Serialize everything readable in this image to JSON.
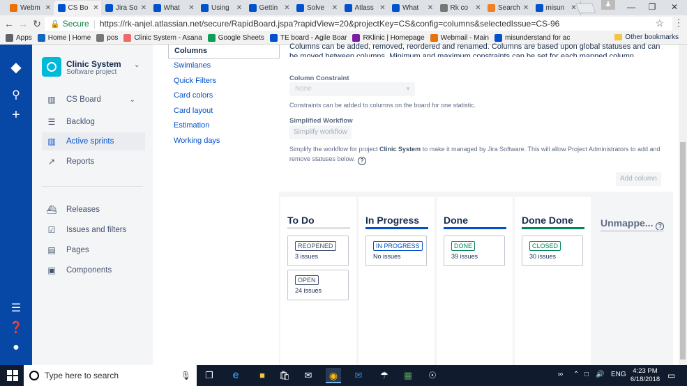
{
  "browser": {
    "tabs": [
      {
        "title": "Webm",
        "favicon": "cp",
        "color": "#e8710a"
      },
      {
        "title": "CS Bo",
        "favicon": "jira",
        "color": "#0052cc",
        "active": true
      },
      {
        "title": "Jira So",
        "favicon": "atlassian",
        "color": "#0052cc"
      },
      {
        "title": "What",
        "favicon": "atlassian",
        "color": "#0052cc"
      },
      {
        "title": "Using",
        "favicon": "atlassian",
        "color": "#0052cc"
      },
      {
        "title": "Gettin",
        "favicon": "atlassian",
        "color": "#0052cc"
      },
      {
        "title": "Solve",
        "favicon": "atlassian",
        "color": "#0052cc"
      },
      {
        "title": "Atlass",
        "favicon": "atlassian",
        "color": "#0052cc"
      },
      {
        "title": "What",
        "favicon": "atlassian",
        "color": "#0052cc"
      },
      {
        "title": "Rk co",
        "favicon": "doc",
        "color": "#777777"
      },
      {
        "title": "Search",
        "favicon": "so",
        "color": "#f48024"
      },
      {
        "title": "misun",
        "favicon": "atlassian",
        "color": "#0052cc"
      }
    ],
    "secure_label": "Secure",
    "url": "https://rk-anjel.atlassian.net/secure/RapidBoard.jspa?rapidView=20&projectKey=CS&config=columns&selectedIssue=CS-96",
    "bookmarks": [
      {
        "label": "Apps",
        "icon": "apps-icon",
        "color": "#5f6368"
      },
      {
        "label": "Home | Home",
        "icon": "home-icon",
        "color": "#1565c0"
      },
      {
        "label": "pos",
        "icon": "doc-icon",
        "color": "#777777"
      },
      {
        "label": "Clinic System - Asana",
        "icon": "asana-icon",
        "color": "#f06a6a"
      },
      {
        "label": "Google Sheets",
        "icon": "sheets-icon",
        "color": "#0f9d58"
      },
      {
        "label": "TE board - Agile Boar",
        "icon": "jira-icon",
        "color": "#0052cc"
      },
      {
        "label": "RKlinic | Homepage",
        "icon": "rk-icon",
        "color": "#7b1fa2"
      },
      {
        "label": "Webmail - Main",
        "icon": "cp-icon",
        "color": "#e8710a"
      },
      {
        "label": "misunderstand for ac",
        "icon": "atlassian-icon",
        "color": "#0052cc"
      }
    ],
    "other_bookmarks": "Other bookmarks"
  },
  "project": {
    "name": "Clinic System",
    "type": "Software project",
    "nav": [
      {
        "label": "CS Board",
        "icon": "board-icon",
        "chevron": true
      },
      {
        "label": "Backlog",
        "icon": "backlog-icon"
      },
      {
        "label": "Active sprints",
        "icon": "sprints-icon",
        "active": true
      },
      {
        "label": "Reports",
        "icon": "reports-icon"
      },
      {
        "label": "Releases",
        "icon": "releases-icon"
      },
      {
        "label": "Issues and filters",
        "icon": "issues-icon"
      },
      {
        "label": "Pages",
        "icon": "pages-icon"
      },
      {
        "label": "Components",
        "icon": "components-icon"
      }
    ]
  },
  "config_menu": {
    "active": "Columns",
    "items": [
      "Swimlanes",
      "Quick Filters",
      "Card colors",
      "Card layout",
      "Estimation",
      "Working days"
    ]
  },
  "main": {
    "intro": "Columns can be added, removed, reordered and renamed. Columns are based upon global statuses and can be moved between columns. Minimum and maximum constraints can be set for each mapped column.",
    "constraint_label": "Column Constraint",
    "constraint_value": "None",
    "constraint_help": "Constraints can be added to columns on the board for one statistic.",
    "workflow_label": "Simplified Workflow",
    "workflow_button": "Simplify workflow",
    "workflow_help_1": "Simplify the workflow for project ",
    "workflow_help_project": "Clinic System",
    "workflow_help_2": " to make it managed by Jira Software. This will allow Project Administrators to add and remove statuses below.",
    "add_column": "Add column",
    "columns": [
      {
        "title": "To Do",
        "bar": "#dfe1e6",
        "cards": [
          {
            "status": "REOPENED",
            "issues": "3 issues",
            "color": "#42526e"
          },
          {
            "status": "OPEN",
            "issues": "24 issues",
            "color": "#42526e"
          }
        ]
      },
      {
        "title": "In Progress",
        "bar": "#0052cc",
        "cards": [
          {
            "status": "IN PROGRESS",
            "issues": "No issues",
            "color": "#0052cc"
          }
        ]
      },
      {
        "title": "Done",
        "bar": "#0052cc",
        "cards": [
          {
            "status": "DONE",
            "issues": "39 issues",
            "color": "#00875a"
          }
        ]
      },
      {
        "title": "Done Done",
        "bar": "#00875a",
        "cards": [
          {
            "status": "CLOSED",
            "issues": "30 issues",
            "color": "#00875a"
          }
        ]
      }
    ],
    "unmapped": "Unmappe..."
  },
  "taskbar": {
    "search_placeholder": "Type here to search",
    "lang": "ENG",
    "time": "4:23 PM",
    "date": "6/18/2018"
  }
}
